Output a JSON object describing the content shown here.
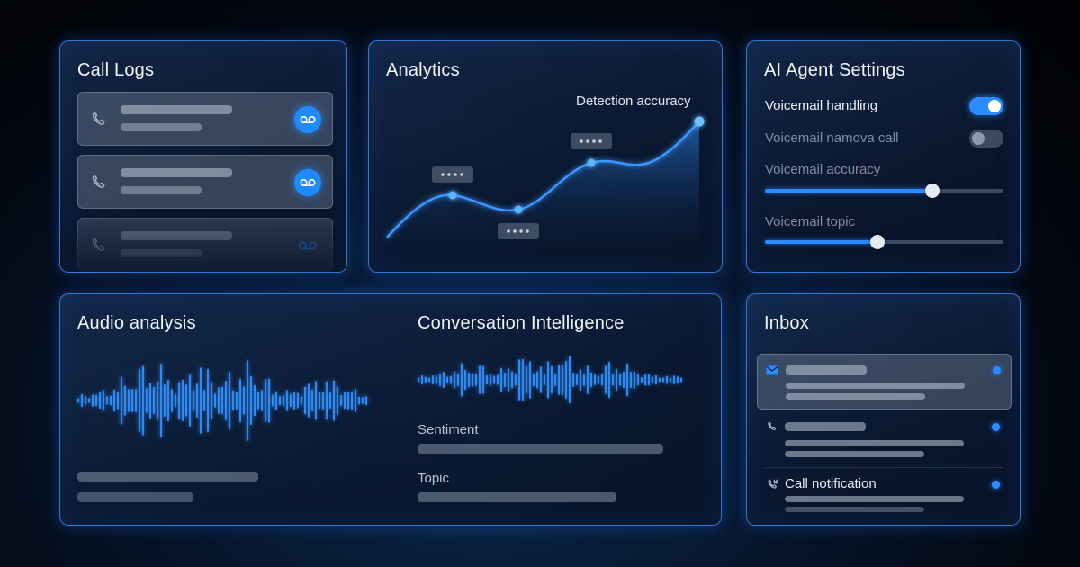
{
  "call_logs": {
    "title": "Call Logs",
    "items": [
      {
        "icon": "phone-icon",
        "badge_icon": "voicemail-icon"
      },
      {
        "icon": "phone-icon",
        "badge_icon": "voicemail-icon"
      },
      {
        "icon": "phone-icon",
        "badge_icon": "voicemail-icon"
      }
    ]
  },
  "analytics": {
    "title": "Analytics",
    "chart_label": "Detection accuracy",
    "tooltip_icon": "ellipsis-icon"
  },
  "ai_settings": {
    "title": "AI Agent Settings",
    "voicemail_handling": {
      "label": "Voicemail handling",
      "enabled": true
    },
    "voicemail_call": {
      "label": "Voicemail namova call",
      "enabled": false
    },
    "voicemail_accuracy": {
      "label": "Voicemail accuracy",
      "value": 0.7
    },
    "voicemail_topic": {
      "label": "Voicemail topic",
      "value": 0.47
    }
  },
  "audio": {
    "title": "Audio analysis",
    "conversation_title": "Conversation Intelligence",
    "sentiment_label": "Sentiment",
    "topic_label": "Topic"
  },
  "inbox": {
    "title": "Inbox",
    "items": [
      {
        "icon": "mail-icon",
        "unread": true
      },
      {
        "icon": "phone-icon",
        "unread": true
      },
      {
        "icon": "phone-incoming-icon",
        "label": "Call notification",
        "unread": true
      }
    ]
  },
  "colors": {
    "accent": "#2b8cff",
    "panel_border": "#4696ff",
    "background": "#02060d"
  }
}
